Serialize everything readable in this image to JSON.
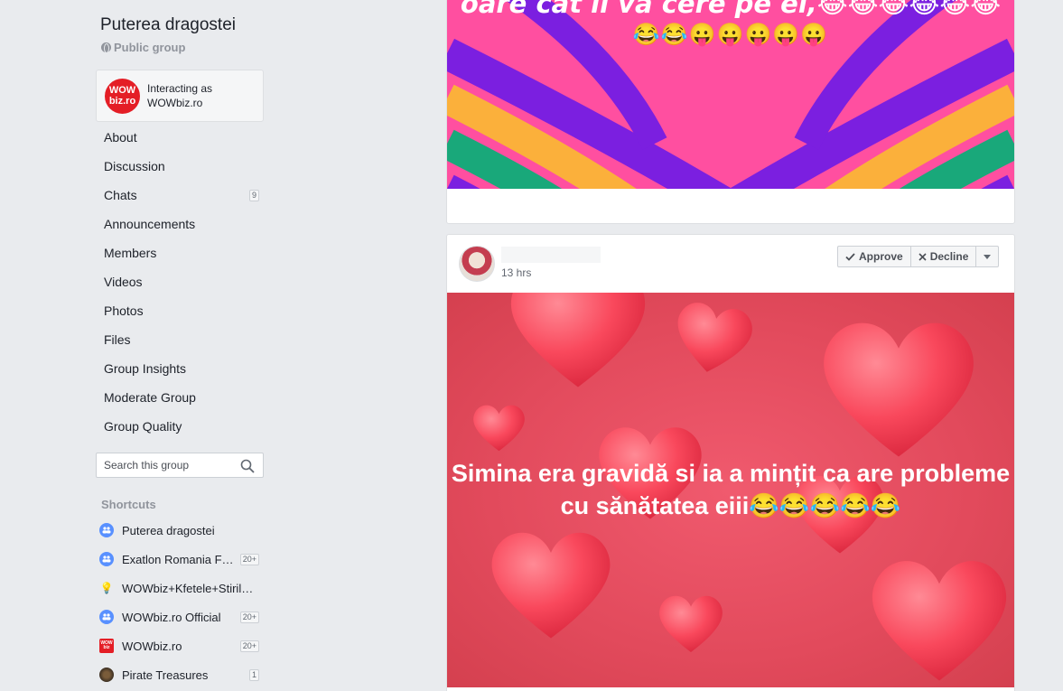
{
  "group": {
    "title": "Puterea dragostei",
    "privacy": "Public group"
  },
  "interacting": {
    "logo_line1": "WOW",
    "logo_line2": "biz.ro",
    "text": "Interacting as WOWbiz.ro"
  },
  "nav": {
    "items": [
      {
        "label": "About"
      },
      {
        "label": "Discussion"
      },
      {
        "label": "Chats",
        "badge": "9"
      },
      {
        "label": "Announcements"
      },
      {
        "label": "Members"
      },
      {
        "label": "Videos"
      },
      {
        "label": "Photos"
      },
      {
        "label": "Files"
      },
      {
        "label": "Group Insights"
      },
      {
        "label": "Moderate Group"
      },
      {
        "label": "Group Quality"
      }
    ]
  },
  "search": {
    "placeholder": "Search this group"
  },
  "shortcuts": {
    "title": "Shortcuts",
    "items": [
      {
        "label": "Puterea dragostei",
        "icon": "group-icon"
      },
      {
        "label": "Exatlon Romania F…",
        "icon": "group-icon",
        "badge": "20+"
      },
      {
        "label": "WOWbiz+Kfetele+Stiril…",
        "icon": "lightbulb-icon"
      },
      {
        "label": "WOWbiz.ro Official",
        "icon": "group-icon",
        "badge": "20+"
      },
      {
        "label": "WOWbiz.ro",
        "icon": "wowbiz-icon",
        "badge": "20+"
      },
      {
        "label": "Pirate Treasures",
        "icon": "pirate-icon",
        "badge": "1"
      }
    ]
  },
  "previous_post": {
    "caption": "oare cât îi va cere pe el,😂😂😂😂😂😂",
    "emojis": "😂😂😛😛😛😛😛",
    "colors": [
      "#ff4fa0",
      "#7b1fe0",
      "#fbb03b",
      "#19a87a",
      "#7b1fe0"
    ]
  },
  "post": {
    "time": "13 hrs",
    "approve_label": "Approve",
    "decline_label": "Decline",
    "text": "Simina era gravidă si ia a mințit ca are probleme cu sănătatea eiii😂😂😂😂😂",
    "bg_color": "#e8505f",
    "heart_color": "#ff5a6a"
  }
}
